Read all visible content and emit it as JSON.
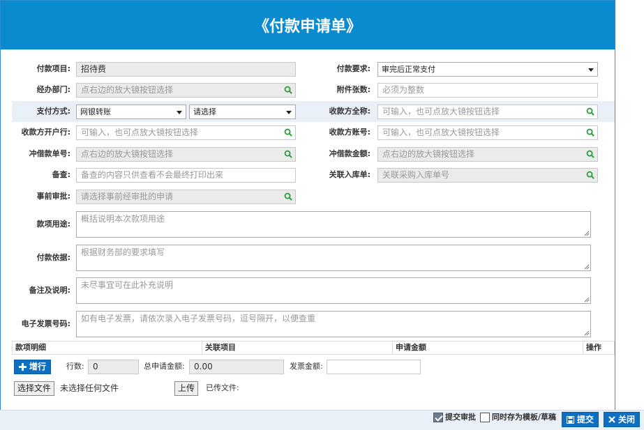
{
  "title": "《付款申请单》",
  "form": {
    "pay_item": {
      "label": "付款项目:",
      "value": "招待费"
    },
    "pay_requirement": {
      "label": "付款要求:",
      "value": "审完后正常支付"
    },
    "department": {
      "label": "经办部门:",
      "placeholder": "点右边的放大镜按钮选择"
    },
    "attachments": {
      "label": "附件张数:",
      "placeholder": "必须为整数"
    },
    "pay_method": {
      "label": "支付方式:",
      "value1": "网银转账",
      "value2": "请选择"
    },
    "payee_name": {
      "label": "收款方全称:",
      "placeholder": "可输入，也可点放大镜按钮选择"
    },
    "payee_bank": {
      "label": "收款方开户行:",
      "placeholder": "可输入，也可点放大镜按钮选择"
    },
    "payee_account": {
      "label": "收款方账号:",
      "placeholder": "可输入，也可点放大镜按钮选择"
    },
    "offset_no": {
      "label": "冲借款单号:",
      "placeholder": "点右边的放大镜按钮选择"
    },
    "offset_amount": {
      "label": "冲借款金额:",
      "placeholder": "点右边的放大镜按钮选择"
    },
    "memo": {
      "label": "备查:",
      "placeholder": "备查的内容只供查看不会最终打印出来"
    },
    "stock_in": {
      "label": "关联入库单:",
      "placeholder": "关联采购入库单号"
    },
    "pre_approval": {
      "label": "事前审批:",
      "placeholder": "请选择事前经审批的申请"
    },
    "purpose": {
      "label": "款项用途:",
      "placeholder": "概括说明本次款项用途"
    },
    "basis": {
      "label": "付款依据:",
      "placeholder": "根据财务部的要求填写"
    },
    "remarks": {
      "label": "备注及说明:",
      "placeholder": "未尽事宜可在此补充说明"
    },
    "invoice_no": {
      "label": "电子发票号码:",
      "placeholder": "如有电子发票，请依次录入电子发票号码，逗号隔开，以便查重"
    }
  },
  "table": {
    "headers": [
      "款项明细",
      "关联项目",
      "申请金额",
      "操作"
    ]
  },
  "detail": {
    "add_row": "增行",
    "row_count_label": "行数:",
    "row_count": "0",
    "total_label": "总申请金额:",
    "total": "0.00",
    "invoice_amount_label": "发票金额:",
    "choose_file": "选择文件",
    "no_file": "未选择任何文件",
    "upload": "上传",
    "uploaded_label": "已传文件:"
  },
  "footer": {
    "submit_approval": "提交审批",
    "save_template": "同时存为模板/草稿",
    "submit": "提交",
    "close": "关闭"
  },
  "colors": {
    "header": "#0a8bd0",
    "button": "#0d6fc1",
    "icon_green": "#2e9e3e"
  }
}
